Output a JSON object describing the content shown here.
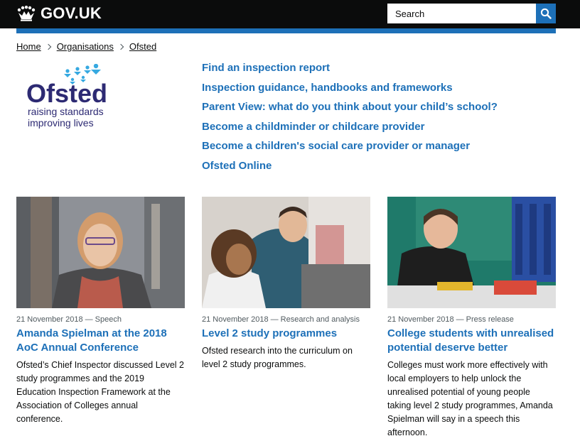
{
  "header": {
    "logo_text": "GOV.UK",
    "search_placeholder": "Search",
    "search_button_label": "Search",
    "brand_color": "#1d70b8"
  },
  "breadcrumb": [
    {
      "label": "Home"
    },
    {
      "label": "Organisations"
    },
    {
      "label": "Ofsted"
    }
  ],
  "org_logo": {
    "name": "Ofsted",
    "tagline_line1": "raising standards",
    "tagline_line2": "improving lives",
    "colors": {
      "figures": "#36a9e1",
      "text": "#2d2a73"
    }
  },
  "quick_links": [
    "Find an inspection report",
    "Inspection guidance, handbooks and frameworks",
    "Parent View: what do you think about your child’s school?",
    "Become a childminder or childcare provider",
    "Become a children's social care provider or manager",
    "Ofsted Online"
  ],
  "featured": [
    {
      "meta": "21 November 2018 — Speech",
      "title": "Amanda Spielman at the 2018 AoC Annual Conference",
      "description": "Ofsted’s Chief Inspector discussed Level 2 study programmes and the 2019 Education Inspection Framework at the Association of Colleges annual conference."
    },
    {
      "meta": "21 November 2018 — Research and analysis",
      "title": "Level 2 study programmes",
      "description": "Ofsted research into the curriculum on level 2 study programmes."
    },
    {
      "meta": "21 November 2018 — Press release",
      "title": "College students with unrealised potential deserve better",
      "description": "Colleges must work more effectively with local employers to help unlock the unrealised potential of young people taking level 2 study programmes, Amanda Spielman will say in a speech this afternoon."
    }
  ]
}
